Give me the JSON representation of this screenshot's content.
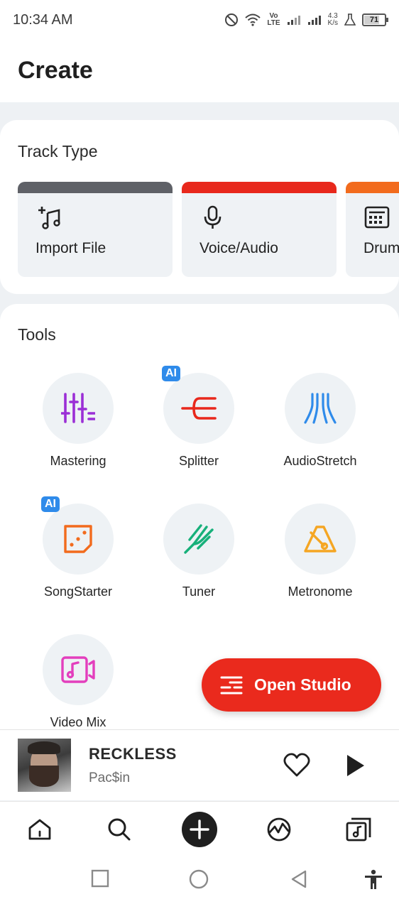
{
  "status_bar": {
    "time": "10:34 AM",
    "network_label": "Vo\nLTE",
    "speed": "4.3\nK/s",
    "battery_level": "71"
  },
  "header": {
    "title": "Create"
  },
  "track_type": {
    "title": "Track Type",
    "tiles": [
      {
        "label": "Import File",
        "icon": "add-music-icon",
        "color": "#5f6167"
      },
      {
        "label": "Voice/Audio",
        "icon": "microphone-icon",
        "color": "#e8281c"
      },
      {
        "label": "Drum",
        "icon": "drum-machine-icon",
        "color": "#f26b1d"
      }
    ]
  },
  "tools": {
    "title": "Tools",
    "ai_badge": "AI",
    "items": [
      {
        "label": "Mastering",
        "icon": "mixer-sliders-icon",
        "color": "#9b2fd6"
      },
      {
        "label": "Splitter",
        "icon": "splitter-icon",
        "color": "#e8281c",
        "ai": true
      },
      {
        "label": "AudioStretch",
        "icon": "stretch-waves-icon",
        "color": "#2f8bea"
      },
      {
        "label": "SongStarter",
        "icon": "dice-icon",
        "color": "#f26b1d",
        "ai": true
      },
      {
        "label": "Tuner",
        "icon": "tuning-fork-icon",
        "color": "#17b07a"
      },
      {
        "label": "Metronome",
        "icon": "metronome-icon",
        "color": "#f5a623"
      },
      {
        "label": "Video Mix",
        "icon": "video-note-icon",
        "color": "#e33fbd"
      }
    ]
  },
  "open_studio": {
    "label": "Open Studio"
  },
  "now_playing": {
    "title": "RECKLESS",
    "artist": "Pac$in"
  },
  "bottom_nav": {
    "items": [
      "home-icon",
      "search-icon",
      "create-plus-icon",
      "feed-icon",
      "library-icon"
    ]
  }
}
